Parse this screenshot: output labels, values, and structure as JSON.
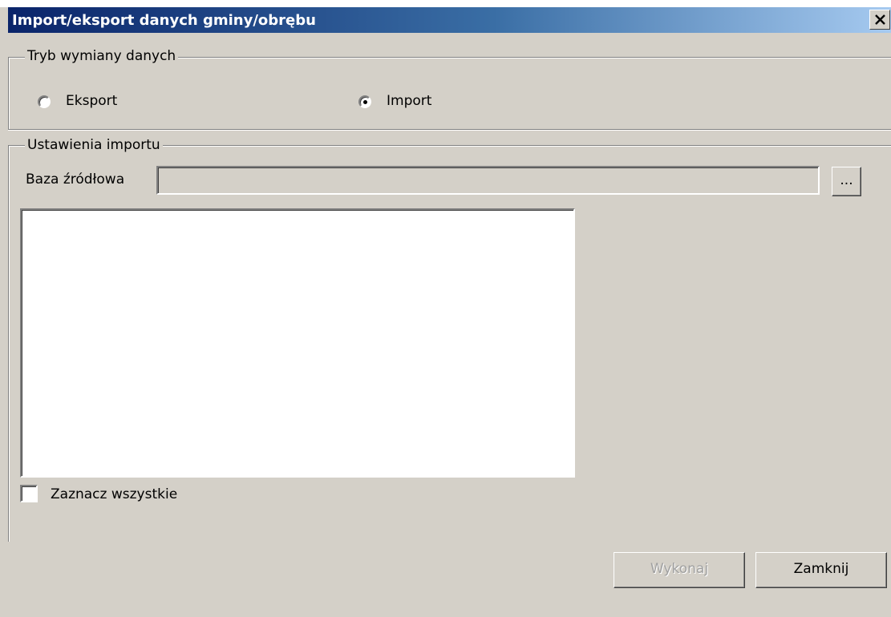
{
  "window": {
    "title": "Import/eksport danych gminy/obrębu"
  },
  "mode_group": {
    "legend": "Tryb wymiany danych",
    "options": [
      {
        "label": "Eksport",
        "selected": false
      },
      {
        "label": "Import",
        "selected": true
      }
    ]
  },
  "import_group": {
    "legend": "Ustawienia importu",
    "source_label": "Baza źródłowa",
    "source_value": "",
    "browse_label": "...",
    "items": [],
    "select_all_label": "Zaznacz wszystkie",
    "select_all_checked": false
  },
  "buttons": {
    "execute_label": "Wykonaj",
    "execute_enabled": false,
    "close_label": "Zamknij"
  },
  "colors": {
    "dialog_bg": "#d4d0c8",
    "titlebar_start": "#0a246a",
    "titlebar_end": "#a6caf0",
    "disabled_text": "#a0a0a0"
  },
  "icons": {
    "close": "close-icon"
  }
}
